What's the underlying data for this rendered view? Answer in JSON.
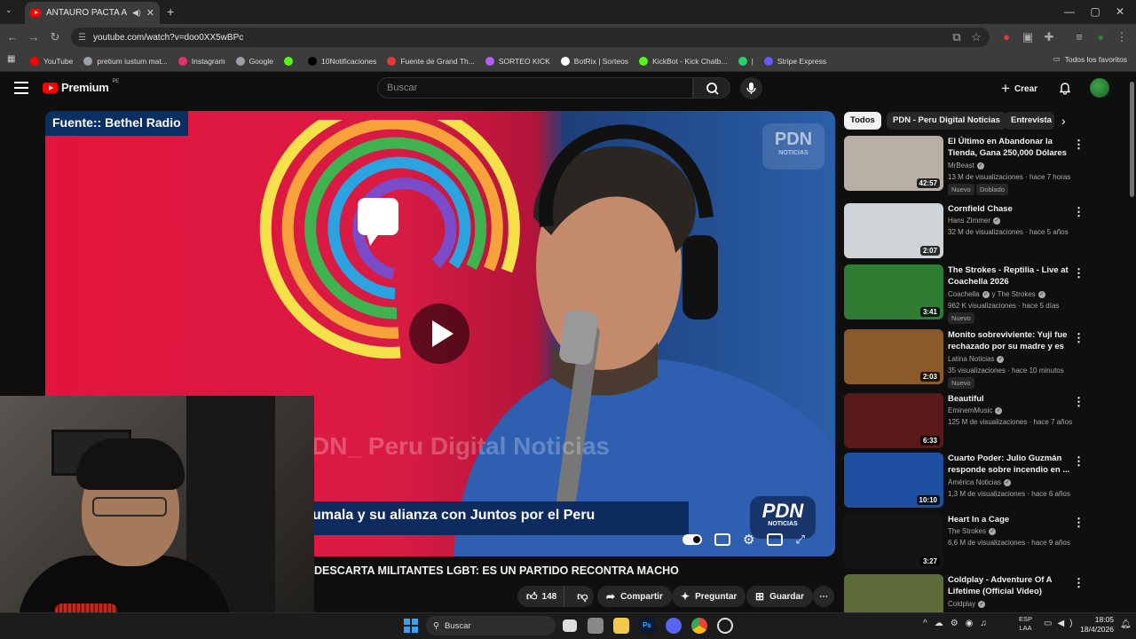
{
  "browser": {
    "tab_title": "ANTAURO PACTA ALIANZA",
    "url": "youtube.com/watch?v=doo0XX5wBPc",
    "bookmarks": [
      {
        "label": "YouTube",
        "color": "#ff0000"
      },
      {
        "label": "pretium iustum mat...",
        "color": "#9aa0a6"
      },
      {
        "label": "Instagram",
        "color": "#e1306c"
      },
      {
        "label": "Google",
        "color": "#9aa0a6"
      },
      {
        "label": "",
        "color": "#53fc18"
      },
      {
        "label": "10Notificaciones",
        "color": "#000000"
      },
      {
        "label": "Fuente de Grand Th...",
        "color": "#e53935"
      },
      {
        "label": "SORTEO KICK",
        "color": "#b45cff"
      },
      {
        "label": "BotRix | Sorteos",
        "color": "#ffffff"
      },
      {
        "label": "KickBot - Kick Chatb...",
        "color": "#53fc18"
      },
      {
        "label": "|",
        "color": "#25d366"
      },
      {
        "label": "Stripe Express",
        "color": "#635bff"
      }
    ],
    "all_bookmarks_label": "Todos los favoritos"
  },
  "youtube": {
    "logo_text": "Premium",
    "logo_region": "PE",
    "search_placeholder": "Buscar",
    "create_label": "Crear",
    "video": {
      "source_tag": "Fuente:: Bethel Radio",
      "subtitle": "umala y su alianza con Juntos por el Peru",
      "watermark": "DN_ Peru Digital Noticias",
      "pdn_logo": "PDN",
      "pdn_logo_sub": "NOTICIAS",
      "title": "DESCARTA MILITANTES LGBT: ES UN PARTIDO RECONTRA MACHO",
      "likes": "148",
      "share_label": "Compartir",
      "ask_label": "Preguntar",
      "save_label": "Guardar"
    },
    "chips": [
      "Todos",
      "PDN - Peru Digital Noticias",
      "Entrevista"
    ],
    "recommendations": [
      {
        "title": "El Último en Abandonar la Tienda, Gana 250,000 Dólares",
        "channel": "MrBeast",
        "meta": "13 M de visualizaciones · hace 7 horas",
        "duration": "42:57",
        "badges": [
          "Nuevo",
          "Doblado"
        ],
        "thumb": "#b8b0a4"
      },
      {
        "title": "Cornfield Chase",
        "channel": "Hans Zimmer",
        "meta": "32 M de visualizaciones · hace 5 años",
        "duration": "2:07",
        "badges": [],
        "thumb": "#cfd4d8"
      },
      {
        "title": "The Strokes - Reptilia - Live at Coachella 2026",
        "channel": "Coachella",
        "channel2": "y The Strokes",
        "meta": "962 K visualizaciones · hace 5 días",
        "duration": "3:41",
        "badges": [
          "Nuevo"
        ],
        "thumb": "#2e7d32"
      },
      {
        "title": "Monito sobreviviente: Yuji fue rechazado por su madre y es ...",
        "channel": "Latina Noticias",
        "meta": "35 visualizaciones · hace 10 minutos",
        "duration": "2:03",
        "badges": [
          "Nuevo"
        ],
        "thumb": "#8a5a2b"
      },
      {
        "title": "Beautiful",
        "channel": "EminemMusic",
        "meta": "125 M de visualizaciones · hace 7 años",
        "duration": "6:33",
        "badges": [],
        "thumb": "#5a1a1a"
      },
      {
        "title": "Cuarto Poder: Julio Guzmán responde sobre incendio en ...",
        "channel": "América Noticias",
        "meta": "1,3 M de visualizaciones · hace 6 años",
        "duration": "10:10",
        "badges": [],
        "thumb": "#1e4fa0"
      },
      {
        "title": "Heart In a Cage",
        "channel": "The Strokes",
        "meta": "6,6 M de visualizaciones · hace 9 años",
        "duration": "3:27",
        "badges": [],
        "thumb": "#141414"
      },
      {
        "title": "Coldplay - Adventure Of A Lifetime (Official Video)",
        "channel": "Coldplay",
        "meta": "",
        "duration": "",
        "badges": [],
        "thumb": "#5d6b3a"
      }
    ]
  },
  "taskbar": {
    "search_label": "Buscar",
    "lang": "ESP",
    "lang2": "LAA",
    "time": "18:05",
    "date": "18/4/2026"
  },
  "colors": {
    "accent": "#ff0000",
    "bg": "#0f0f0f"
  }
}
